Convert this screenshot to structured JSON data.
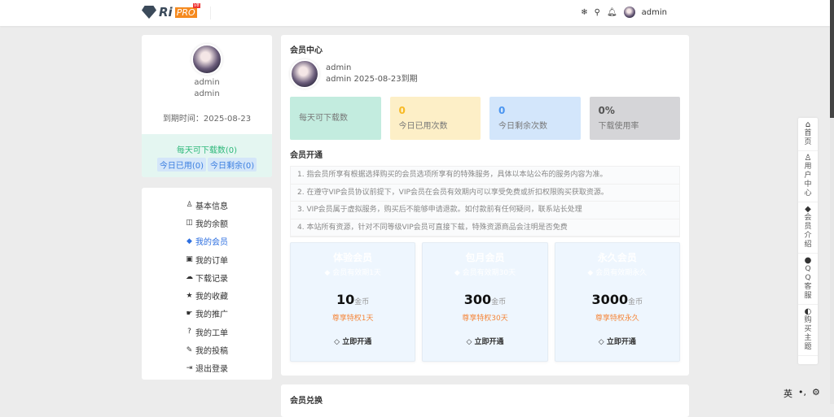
{
  "header": {
    "logo": "RiPRO",
    "logo_badge": "V8",
    "user": "admin",
    "icons": [
      "snowflake-icon",
      "search-icon",
      "bell-icon"
    ]
  },
  "profile": {
    "name": "admin",
    "subname": "admin",
    "expire": "到期时间：2025-08-23",
    "daily": "每天可下载数(0)",
    "used": "今日已用(0)",
    "left": "今日剩余(0)"
  },
  "menu": [
    {
      "icon": "user-icon",
      "glyph": "♙",
      "label": "基本信息"
    },
    {
      "icon": "coins-icon",
      "glyph": "◫",
      "label": "我的余额"
    },
    {
      "icon": "diamond-icon",
      "glyph": "◆",
      "label": "我的会员",
      "active": true
    },
    {
      "icon": "bag-icon",
      "glyph": "▣",
      "label": "我的订单"
    },
    {
      "icon": "cloud-download-icon",
      "glyph": "☁",
      "label": "下载记录"
    },
    {
      "icon": "star-icon",
      "glyph": "★",
      "label": "我的收藏"
    },
    {
      "icon": "hand-icon",
      "glyph": "☛",
      "label": "我的推广"
    },
    {
      "icon": "question-icon",
      "glyph": "?",
      "label": "我的工单"
    },
    {
      "icon": "edit-icon",
      "glyph": "✎",
      "label": "我的投稿"
    },
    {
      "icon": "logout-icon",
      "glyph": "⇥",
      "label": "退出登录"
    }
  ],
  "main": {
    "title": "会员中心",
    "user_name": "admin",
    "user_info": "admin 2025-08-23到期",
    "stats": [
      {
        "value": "",
        "label": "每天可下载数",
        "bg": "#c3ecdf",
        "color": "#2eb87a"
      },
      {
        "value": "0",
        "label": "今日已用次数",
        "bg": "#fdefc7",
        "color": "#f7b924"
      },
      {
        "value": "0",
        "label": "今日剩余次数",
        "bg": "#d3e6fb",
        "color": "#4a95f0"
      },
      {
        "value": "0%",
        "label": "下载使用率",
        "bg": "#d5d5d8",
        "color": "#555"
      }
    ],
    "open_title": "会员开通",
    "steps": [
      "1. 指会员所享有根据选择购买的会员选项所享有的特殊服务，具体以本站公布的服务内容为准。",
      "2. 在遵守VIP会员协议前提下，VIP会员在会员有效期内可以享受免费或折扣权限购买获取资源。",
      "3. VIP会员属于虚拟服务，购买后不能够申请退款。如付款前有任何疑问，联系站长处理",
      "4. 本站所有资源，针对不同等级VIP会员可直接下载，特殊资源商品会注明是否免费"
    ],
    "plans": [
      {
        "title": "体验会员",
        "sub": "会员有效期1天",
        "price": "10",
        "unit": "金币",
        "perk": "尊享特权1天",
        "btn": "立即开通"
      },
      {
        "title": "包月会员",
        "sub": "会员有效期30天",
        "price": "300",
        "unit": "金币",
        "perk": "尊享特权30天",
        "btn": "立即开通"
      },
      {
        "title": "永久会员",
        "sub": "会员有效期永久",
        "price": "3000",
        "unit": "金币",
        "perk": "尊享特权永久",
        "btn": "立即开通"
      }
    ],
    "exchange_title": "会员兑换"
  },
  "floatbar": [
    {
      "icon": "home-icon",
      "glyph": "⌂",
      "label": "首页"
    },
    {
      "icon": "user-icon",
      "glyph": "♙",
      "label": "用户中心"
    },
    {
      "icon": "diamond-icon",
      "glyph": "◆",
      "label": "会员介绍"
    },
    {
      "icon": "qq-icon",
      "glyph": "●",
      "label": "QQ客服"
    },
    {
      "icon": "theme-icon",
      "glyph": "◐",
      "label": "购买主题"
    }
  ],
  "ime": {
    "lang": "英",
    "punct": "•,"
  }
}
